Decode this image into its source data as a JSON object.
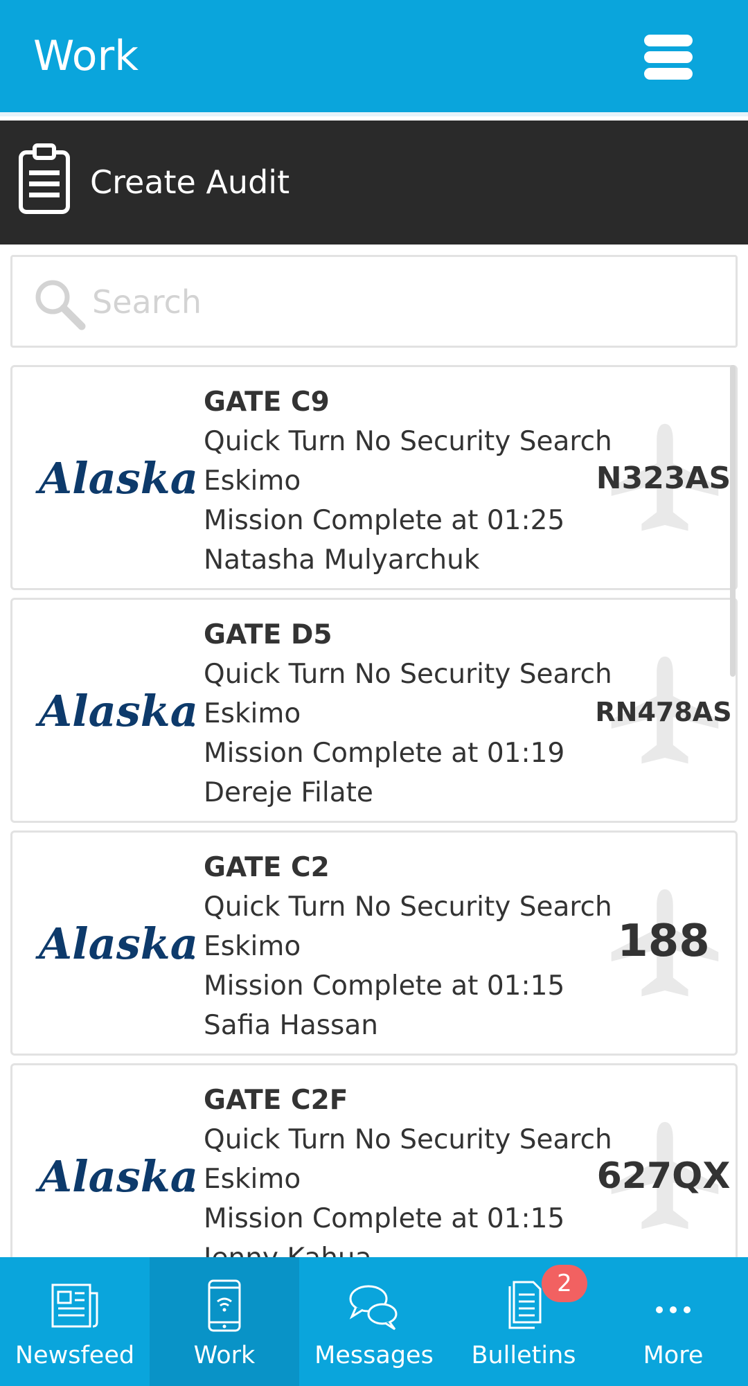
{
  "header": {
    "title": "Work"
  },
  "audit_bar": {
    "label": "Create Audit"
  },
  "search": {
    "placeholder": "Search",
    "value": ""
  },
  "cards": [
    {
      "gate": "GATE C9",
      "type": "Quick Turn No Security Search",
      "team": "Eskimo",
      "status": "Mission Complete at 01:25",
      "person": "Natasha Mulyarchuk",
      "tail": "N323AS",
      "airline": "Alaska"
    },
    {
      "gate": "GATE D5",
      "type": "Quick Turn No Security Search",
      "team": "Eskimo",
      "status": "Mission Complete at 01:19",
      "person": "Dereje Filate",
      "tail": "RN478AS",
      "airline": "Alaska"
    },
    {
      "gate": "GATE C2",
      "type": "Quick Turn No Security Search",
      "team": "Eskimo",
      "status": "Mission Complete at 01:15",
      "person": "Safia Hassan",
      "tail": "188",
      "airline": "Alaska"
    },
    {
      "gate": "GATE C2F",
      "type": "Quick Turn No Security Search",
      "team": "Eskimo",
      "status": "Mission Complete at 01:15",
      "person": "Jenny Kahua",
      "tail": "627QX",
      "airline": "Alaska"
    }
  ],
  "bottom_nav": {
    "items": [
      {
        "label": "Newsfeed",
        "icon": "newspaper-icon"
      },
      {
        "label": "Work",
        "icon": "phone-icon",
        "active": true
      },
      {
        "label": "Messages",
        "icon": "chat-bubbles-icon"
      },
      {
        "label": "Bulletins",
        "icon": "documents-icon",
        "badge": "2"
      },
      {
        "label": "More",
        "icon": "more-dots-icon"
      }
    ]
  },
  "colors": {
    "primary": "#0aa5dc",
    "dark_bar": "#2a2a2a",
    "badge": "#f26161",
    "alaska_blue": "#0d3a6b"
  }
}
